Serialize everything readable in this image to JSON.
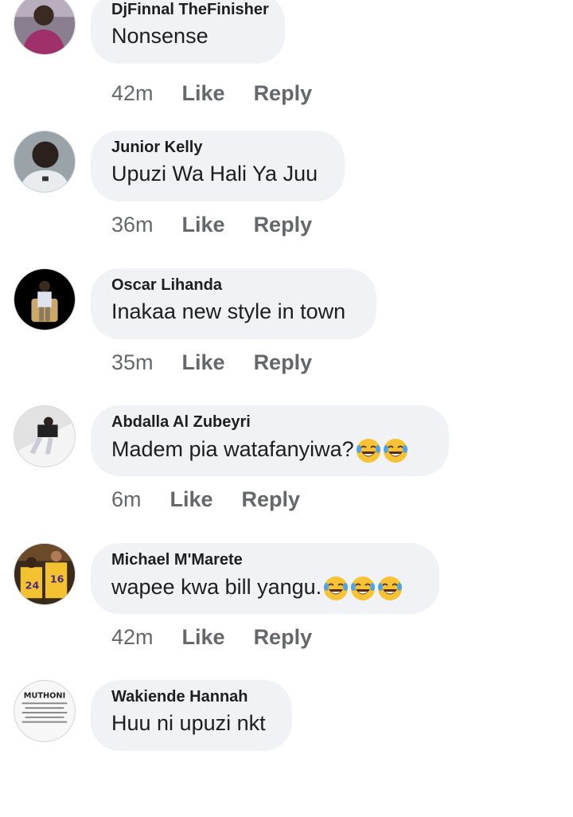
{
  "comments": [
    {
      "author": "DjFinnal TheFinisher",
      "text": "Nonsense",
      "emoji_count": 0,
      "time": "42m",
      "like": "Like",
      "reply": "Reply"
    },
    {
      "author": "Junior Kelly",
      "text": "Upuzi Wa Hali Ya Juu",
      "emoji_count": 0,
      "time": "36m",
      "like": "Like",
      "reply": "Reply"
    },
    {
      "author": "Oscar Lihanda",
      "text": "Inakaa new style in town",
      "emoji_count": 0,
      "time": "35m",
      "like": "Like",
      "reply": "Reply"
    },
    {
      "author": "Abdalla Al Zubeyri",
      "text": "Madem pia watafanyiwa?",
      "emoji_count": 2,
      "time": "6m",
      "like": "Like",
      "reply": "Reply"
    },
    {
      "author": "Michael M'Marete",
      "text": "wapee kwa bill yangu.",
      "emoji_count": 3,
      "time": "42m",
      "like": "Like",
      "reply": "Reply"
    },
    {
      "author": "Wakiende Hannah",
      "text": "Huu ni upuzi nkt",
      "emoji_count": 0,
      "time": "",
      "like": "",
      "reply": ""
    }
  ],
  "avatars": {
    "a0": {
      "icon": "profile-photo-man"
    },
    "a1": {
      "icon": "profile-photo-man-selfie"
    },
    "a2": {
      "icon": "profile-photo-man-sitting"
    },
    "a3": {
      "icon": "profile-photo-man-standing"
    },
    "a4": {
      "icon": "profile-photo-basketball-players",
      "jersey_numbers": [
        "24",
        "16"
      ]
    },
    "a5": {
      "icon": "profile-photo-quote-card",
      "heading": "MUTHONI"
    }
  },
  "emoji": {
    "name": "face-with-tears-of-joy-icon"
  },
  "colors": {
    "bubble": "#f0f2f5",
    "meta": "#65676b",
    "text": "#1c1e21"
  }
}
